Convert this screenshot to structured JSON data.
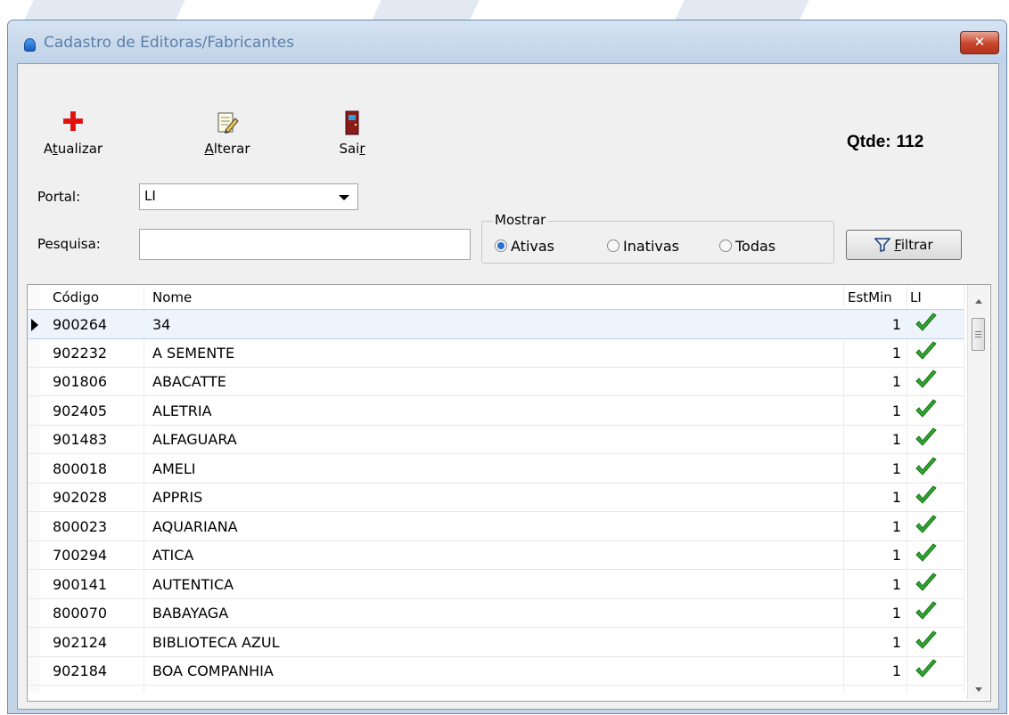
{
  "window": {
    "title": "Cadastro de Editoras/Fabricantes",
    "close_glyph": "✕"
  },
  "toolbar": {
    "atualizar": {
      "pre": "A",
      "ul": "t",
      "post": "ualizar",
      "icon": "plus-icon"
    },
    "alterar": {
      "pre": "",
      "ul": "A",
      "post": "lterar",
      "icon": "edit-document-icon"
    },
    "sair": {
      "pre": "Sai",
      "ul": "r",
      "post": "",
      "icon": "exit-door-icon"
    }
  },
  "qtde": {
    "label": "Qtde:",
    "value": "112"
  },
  "portal": {
    "label": "Portal:",
    "value": "LI"
  },
  "pesquisa": {
    "label": "Pesquisa:",
    "value": ""
  },
  "mostrar": {
    "title": "Mostrar",
    "options": [
      "Ativas",
      "Inativas",
      "Todas"
    ],
    "selected": "Ativas"
  },
  "filtrar": {
    "pre": "",
    "ul": "F",
    "post": "iltrar",
    "icon": "funnel-icon"
  },
  "grid": {
    "columns": [
      "Código",
      "Nome",
      "EstMin",
      "LI"
    ],
    "rows": [
      {
        "codigo": "900264",
        "nome": "34",
        "estmin": "1"
      },
      {
        "codigo": "902232",
        "nome": "A SEMENTE",
        "estmin": "1"
      },
      {
        "codigo": "901806",
        "nome": "ABACATTE",
        "estmin": "1"
      },
      {
        "codigo": "902405",
        "nome": "ALETRIA",
        "estmin": "1"
      },
      {
        "codigo": "901483",
        "nome": "ALFAGUARA",
        "estmin": "1"
      },
      {
        "codigo": "800018",
        "nome": "AMELI",
        "estmin": "1"
      },
      {
        "codigo": "902028",
        "nome": "APPRIS",
        "estmin": "1"
      },
      {
        "codigo": "800023",
        "nome": "AQUARIANA",
        "estmin": "1"
      },
      {
        "codigo": "700294",
        "nome": "ATICA",
        "estmin": "1"
      },
      {
        "codigo": "900141",
        "nome": "AUTENTICA",
        "estmin": "1"
      },
      {
        "codigo": "800070",
        "nome": "BABAYAGA",
        "estmin": "1"
      },
      {
        "codigo": "902124",
        "nome": "BIBLIOTECA AZUL",
        "estmin": "1"
      },
      {
        "codigo": "902184",
        "nome": "BOA COMPANHIA",
        "estmin": "1"
      }
    ]
  },
  "colors": {
    "check": "#2ea82e",
    "title_text": "#5c7fa8",
    "close_button": "#c8442c"
  }
}
